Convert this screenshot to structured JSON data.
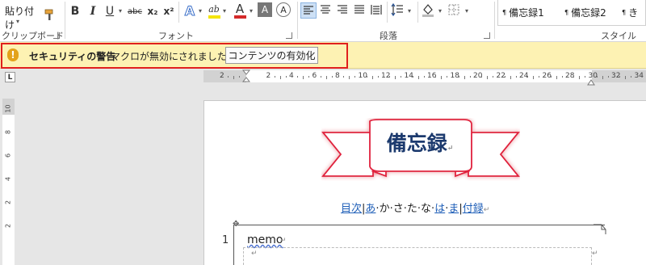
{
  "ribbon": {
    "paste_label": "貼り付け",
    "groups": {
      "clipboard": "クリップボード",
      "font": "フォント",
      "paragraph": "段落",
      "styles": "スタイル"
    },
    "font_buttons": {
      "bold": "B",
      "italic": "I",
      "underline": "U",
      "strike": "abc",
      "subscript": "x₂",
      "superscript": "x²"
    },
    "text_effect": "A",
    "highlight": "ab",
    "font_color": "A",
    "clear_format": "A",
    "char_circle": "A",
    "styles": [
      "備忘録1",
      "備忘録2",
      "き"
    ],
    "colors": {
      "highlight": "#f4e40a",
      "font_color": "#d42a2a",
      "accent": "#2b579a"
    }
  },
  "security_bar": {
    "title": "セキュリティの警告",
    "message": "マクロが無効にされました。",
    "button": "コンテンツの有効化",
    "icon": "!"
  },
  "rulers": {
    "tab_selector": "L",
    "h_ticks": [
      "2",
      "2",
      "4",
      "6",
      "8",
      "10",
      "12",
      "14",
      "16",
      "18",
      "20",
      "22",
      "24",
      "26",
      "28",
      "30",
      "32",
      "34"
    ],
    "v_ticks": [
      "10",
      "8",
      "6",
      "4",
      "2",
      "2"
    ]
  },
  "document": {
    "banner_title": "備忘録",
    "return_mark": "↵",
    "nav_links": [
      "目次",
      "あ",
      "か",
      "さ",
      "た",
      "な",
      "は",
      "ま",
      "付録"
    ],
    "nav_seps": [
      "|",
      "|",
      "·",
      "·",
      "·",
      "·",
      "|",
      "·",
      "|"
    ],
    "line_number": "1",
    "memo": "memo"
  }
}
